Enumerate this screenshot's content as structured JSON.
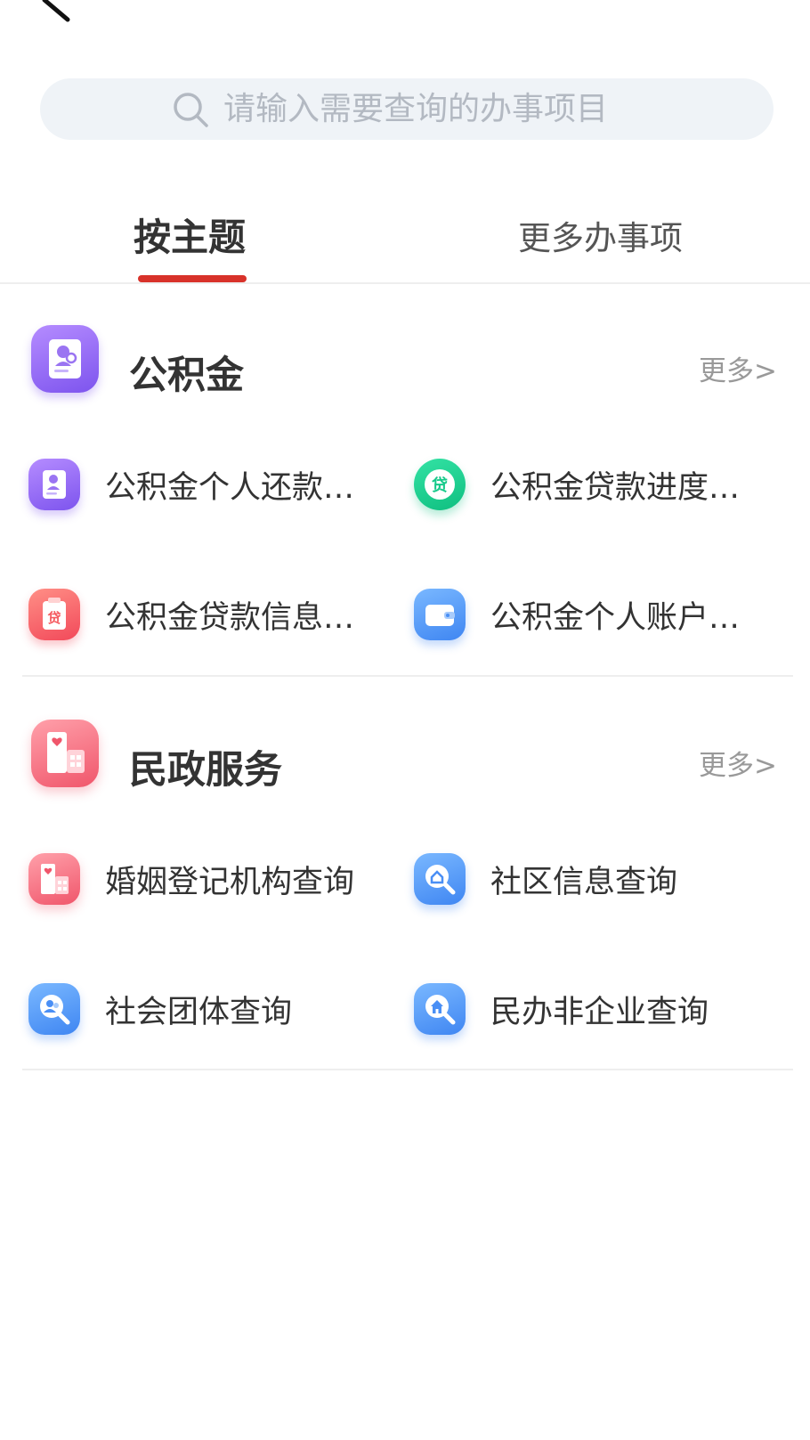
{
  "search": {
    "placeholder": "请输入需要查询的办事项目"
  },
  "tabs": [
    {
      "label": "按主题",
      "active": true
    },
    {
      "label": "更多办事项",
      "active": false
    }
  ],
  "sections": [
    {
      "title": "公积金",
      "more": "更多>",
      "icon": "id-card-icon",
      "items": [
        {
          "label": "公积金个人还款…",
          "icon": "id-card-icon",
          "color": "#8a5cf5"
        },
        {
          "label": "公积金贷款进度…",
          "icon": "loan-coin-icon",
          "color": "#16c98a"
        },
        {
          "label": "公积金贷款信息…",
          "icon": "loan-clipboard-icon",
          "color": "#f55a5f"
        },
        {
          "label": "公积金个人账户…",
          "icon": "wallet-icon",
          "color": "#4a8ff5"
        }
      ]
    },
    {
      "title": "民政服务",
      "more": "更多>",
      "icon": "building-heart-icon",
      "items": [
        {
          "label": "婚姻登记机构查询",
          "icon": "building-heart-icon",
          "color": "#f0566b"
        },
        {
          "label": "社区信息查询",
          "icon": "community-search-icon",
          "color": "#4a8ff5"
        },
        {
          "label": "社会团体查询",
          "icon": "group-search-icon",
          "color": "#4a8ff5"
        },
        {
          "label": "民办非企业查询",
          "icon": "house-search-icon",
          "color": "#4a8ff5"
        }
      ]
    }
  ],
  "colors": {
    "accent": "#d8322a",
    "search_bg": "#eff3f7"
  }
}
